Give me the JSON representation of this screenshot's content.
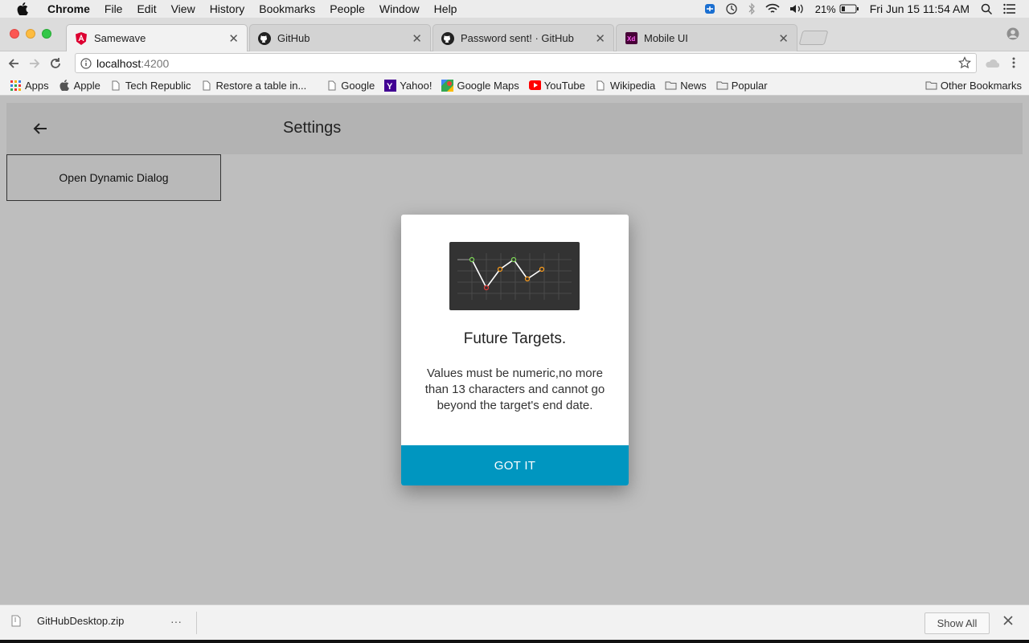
{
  "menubar": {
    "items": [
      "Chrome",
      "File",
      "Edit",
      "View",
      "History",
      "Bookmarks",
      "People",
      "Window",
      "Help"
    ],
    "battery": "21%",
    "clock": "Fri Jun 15  11:54 AM"
  },
  "tabs": [
    {
      "title": "Samewave",
      "icon": "angular-icon"
    },
    {
      "title": "GitHub",
      "icon": "github-icon"
    },
    {
      "title": "Password sent! · GitHub",
      "icon": "github-icon"
    },
    {
      "title": "Mobile UI",
      "icon": "adobe-xd-icon"
    }
  ],
  "address": {
    "host": "localhost",
    "port": ":4200"
  },
  "bookmarks": [
    "Apps",
    "Apple",
    "Tech Republic",
    "Restore a table in...",
    "Google",
    "Yahoo!",
    "Google Maps",
    "YouTube",
    "Wikipedia",
    "News",
    "Popular"
  ],
  "other_bookmarks": "Other Bookmarks",
  "app": {
    "header_title": "Settings",
    "open_dialog_label": "Open Dynamic Dialog"
  },
  "dialog": {
    "title": "Future Targets.",
    "body": "Values must be numeric,no more than 13 characters and cannot go beyond the target's end date.",
    "button": "GOT IT"
  },
  "download": {
    "filename": "GitHubDesktop.zip",
    "show_all": "Show All"
  },
  "colors": {
    "accent": "#0096c0",
    "chart_bg": "#333333"
  }
}
